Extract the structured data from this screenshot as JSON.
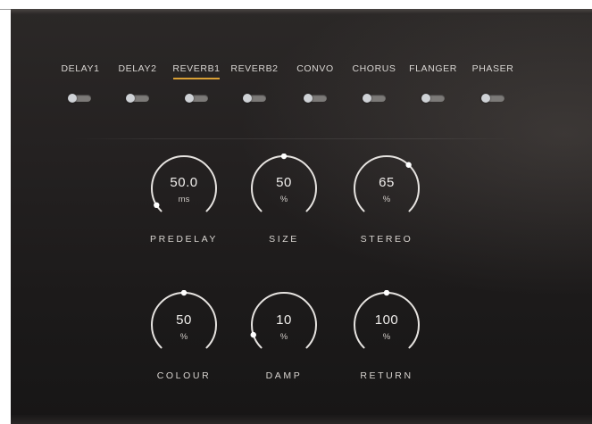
{
  "tabs": [
    {
      "label": "DELAY1",
      "active": false
    },
    {
      "label": "DELAY2",
      "active": false
    },
    {
      "label": "REVERB1",
      "active": true
    },
    {
      "label": "REVERB2",
      "active": false
    },
    {
      "label": "CONVO",
      "active": false
    },
    {
      "label": "CHORUS",
      "active": false
    },
    {
      "label": "FLANGER",
      "active": false
    },
    {
      "label": "PHASER",
      "active": false
    }
  ],
  "toggles": [
    {
      "on": false
    },
    {
      "on": false
    },
    {
      "on": false
    },
    {
      "on": false
    },
    {
      "on": false
    },
    {
      "on": false
    },
    {
      "on": false
    },
    {
      "on": false
    }
  ],
  "knobs": [
    {
      "value": "50.0",
      "unit": "ms",
      "label": "PREDELAY",
      "level": 0.05
    },
    {
      "value": "50",
      "unit": "%",
      "label": "SIZE",
      "level": 0.5
    },
    {
      "value": "65",
      "unit": "%",
      "label": "STEREO",
      "level": 0.66
    },
    {
      "value": "50",
      "unit": "%",
      "label": "COLOUR",
      "level": 0.5
    },
    {
      "value": "10",
      "unit": "%",
      "label": "DAMP",
      "level": 0.1
    },
    {
      "value": "100",
      "unit": "%",
      "label": "RETURN",
      "level": 0.5
    }
  ],
  "colors": {
    "accent": "#d9a035",
    "knob_arc": "#e6e3e0",
    "knob_dot": "#ffffff",
    "text": "#d9d6d3"
  }
}
